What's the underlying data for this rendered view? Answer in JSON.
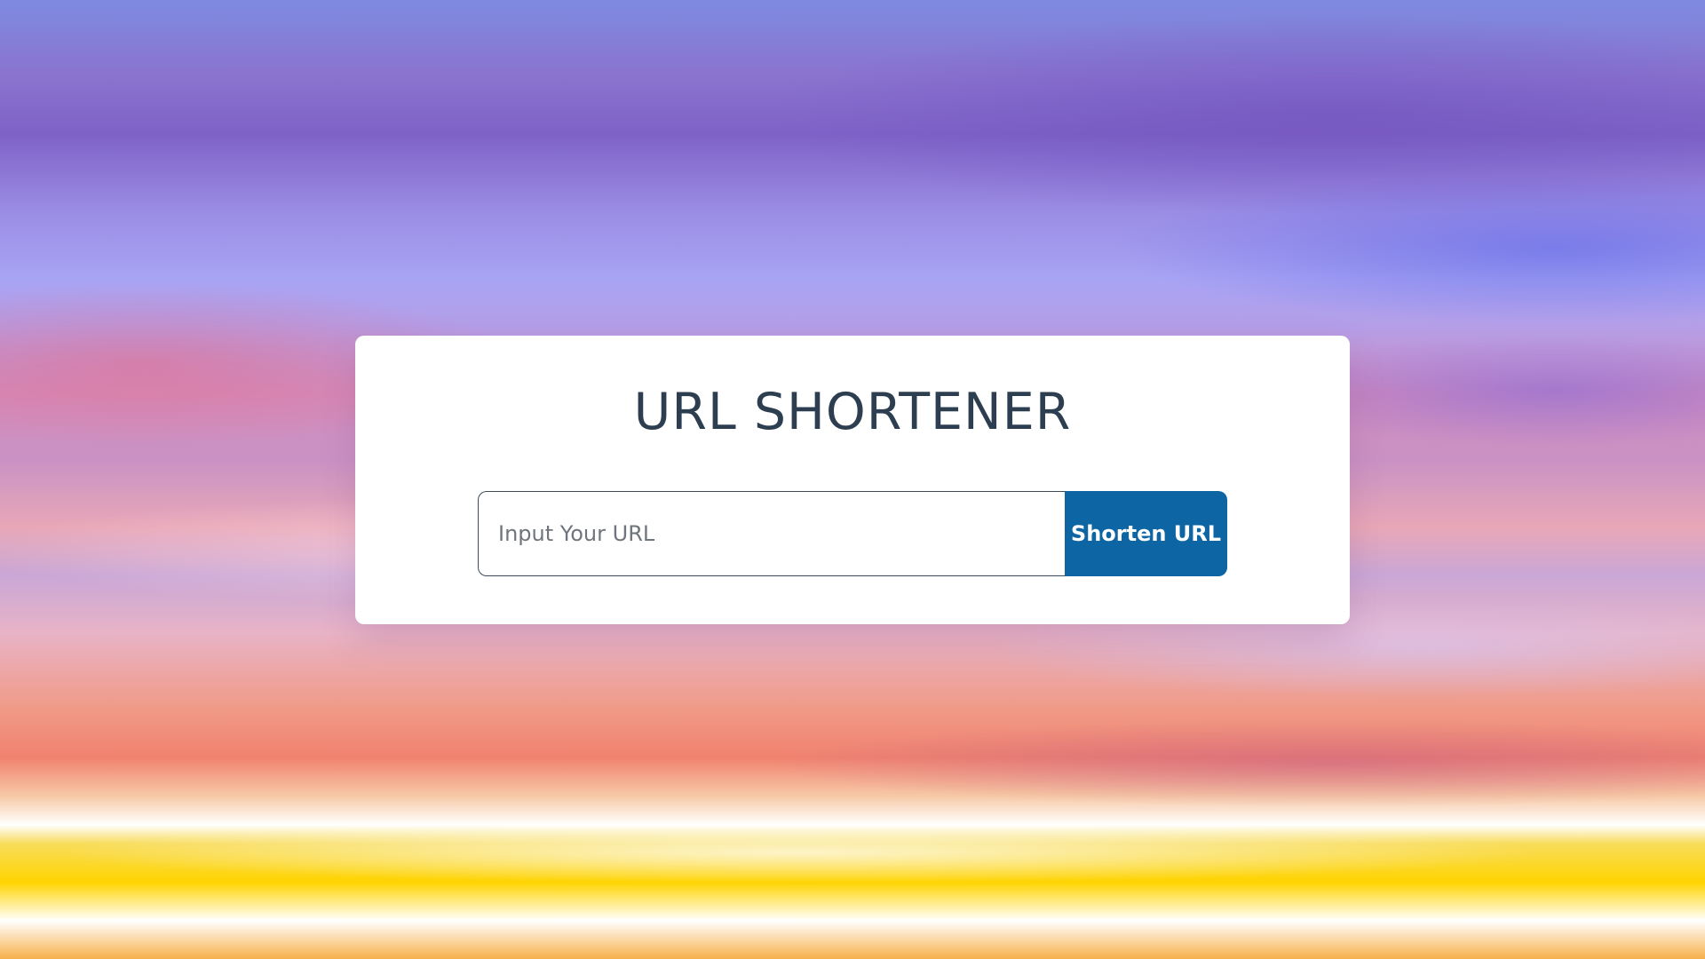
{
  "page": {
    "title": "URL SHORTENER"
  },
  "form": {
    "input_placeholder": "Input Your URL",
    "input_value": "",
    "button_label": "Shorten URL"
  },
  "colors": {
    "button_background": "#0d66a3",
    "title_text": "#2c3e50",
    "card_background": "#ffffff"
  }
}
